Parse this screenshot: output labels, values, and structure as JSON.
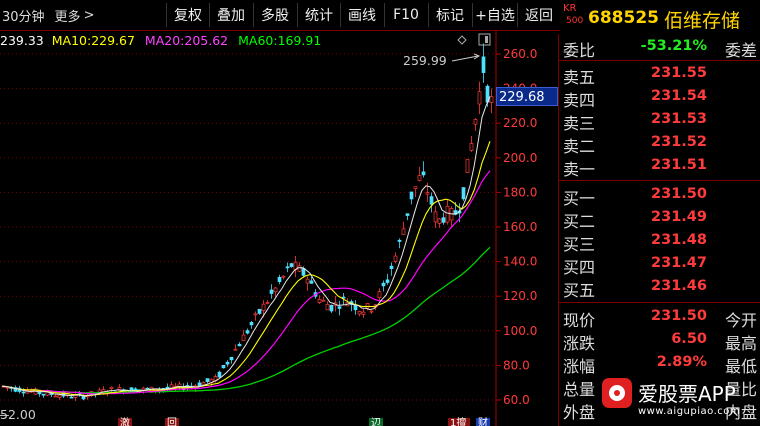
{
  "toolbar": {
    "period": "30分钟",
    "more": "更多",
    "more_arrow": ">",
    "buttons": [
      "复权",
      "叠加",
      "多股",
      "统计",
      "画线",
      "F10",
      "标记",
      "+自选",
      "返回"
    ]
  },
  "stock": {
    "market_top": "KR",
    "market_bottom": "500",
    "code": "688525",
    "name": "佰维存储"
  },
  "ma": {
    "ma5": "239.33",
    "ma10_label": "MA10:",
    "ma10": "229.67",
    "ma20_label": "MA20:",
    "ma20": "205.62",
    "ma60_label": "MA60:",
    "ma60": "169.91",
    "colors": {
      "ma5": "#ffffff",
      "ma10": "#ffff00",
      "ma20": "#ff00ff",
      "ma60": "#00ff00"
    }
  },
  "chart": {
    "high_mark": "259.99",
    "current_price": "229.68",
    "low_mark": "52.00",
    "y_ticks": [
      "260.0",
      "240.0",
      "220.0",
      "200.0",
      "180.0",
      "160.0",
      "140.0",
      "120.0",
      "100.0",
      "80.0",
      "60.0"
    ],
    "bottom_markers": [
      "激",
      "回",
      "辺",
      "1擅",
      "财"
    ]
  },
  "book": {
    "weibi_label": "委比",
    "weibi_value": "-53.21%",
    "weicha_label": "委差",
    "asks": [
      {
        "label": "卖五",
        "price": "231.55"
      },
      {
        "label": "卖四",
        "price": "231.54"
      },
      {
        "label": "卖三",
        "price": "231.53"
      },
      {
        "label": "卖二",
        "price": "231.52"
      },
      {
        "label": "卖一",
        "price": "231.51"
      }
    ],
    "bids": [
      {
        "label": "买一",
        "price": "231.50"
      },
      {
        "label": "买二",
        "price": "231.49"
      },
      {
        "label": "买三",
        "price": "231.48"
      },
      {
        "label": "买四",
        "price": "231.47"
      },
      {
        "label": "买五",
        "price": "231.46"
      }
    ]
  },
  "quote": [
    {
      "label": "现价",
      "value": "231.50",
      "label2": "今开"
    },
    {
      "label": "涨跌",
      "value": "6.50",
      "label2": "最高"
    },
    {
      "label": "涨幅",
      "value": "2.89%",
      "label2": "最低"
    },
    {
      "label": "总量",
      "value": "",
      "label2": "量比"
    },
    {
      "label": "外盘",
      "value": "",
      "label2": "内盘"
    }
  ],
  "watermark": {
    "brand": "爱股票APP",
    "url": "www.aigupiao.com"
  }
}
